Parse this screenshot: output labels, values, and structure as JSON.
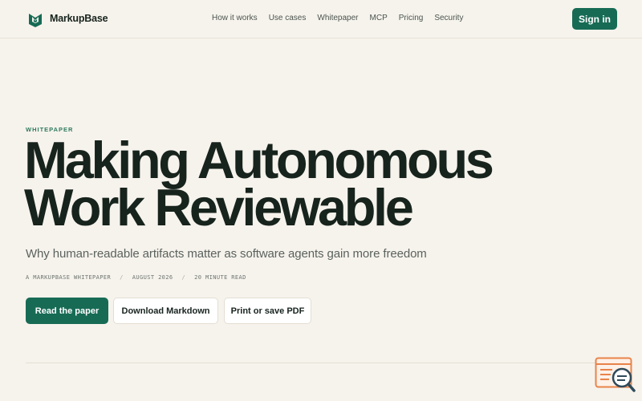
{
  "header": {
    "brand": "MarkupBase",
    "nav": [
      "How it works",
      "Use cases",
      "Whitepaper",
      "MCP",
      "Pricing",
      "Security"
    ],
    "signin": "Sign in"
  },
  "hero": {
    "eyebrow": "WHITEPAPER",
    "title_line1": "Making Autonomous",
    "title_line2": "Work Reviewable",
    "subtitle": "Why human-readable artifacts matter as software agents gain more freedom",
    "meta": [
      "A MARKUPBASE WHITEPAPER",
      "AUGUST 2026",
      "20 MINUTE READ"
    ],
    "meta_sep": "/",
    "buttons": {
      "read": "Read the paper",
      "download": "Download Markdown",
      "print": "Print or save PDF"
    }
  },
  "icons": {
    "logo": "markupbase-logo-icon",
    "widget": "search-document-icon"
  },
  "colors": {
    "background": "#f6f3ec",
    "accent": "#176b55",
    "widget": "#e9834a"
  }
}
